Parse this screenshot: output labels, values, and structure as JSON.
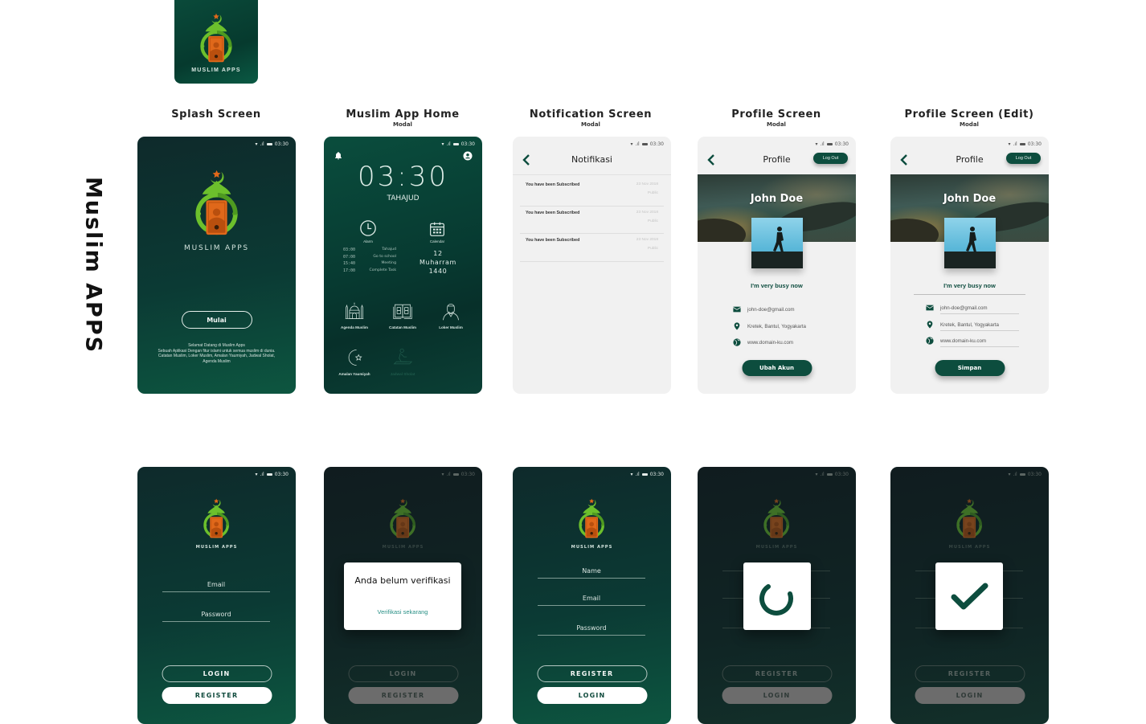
{
  "page": {
    "vertical_title": "Muslim APPS",
    "app_icon": {
      "brand": "MUSLIM APPS"
    }
  },
  "columns": [
    {
      "title": "Splash Screen",
      "subtitle": ""
    },
    {
      "title": "Muslim App Home",
      "subtitle": "Modal"
    },
    {
      "title": "Notification Screen",
      "subtitle": "Modal"
    },
    {
      "title": "Profile Screen",
      "subtitle": "Modal"
    },
    {
      "title": "Profile Screen (Edit)",
      "subtitle": "Modal"
    }
  ],
  "statusbar": {
    "time": "03:30",
    "icons": [
      "wifi-icon",
      "signal-icon",
      "battery-icon"
    ]
  },
  "colors": {
    "primary": "#0d4d3e",
    "logo_green": "#6cc02c",
    "logo_orange": "#e0681a",
    "star": "#e0681a",
    "link": "#2a9086"
  },
  "splash": {
    "brand": "MUSLIM APPS",
    "start_button": "Mulai",
    "welcome_lines": [
      "Selamat Datang di Muslim Apps",
      "Sebuah Aplikasi Dengan fitur islami untuk semua muslim di dunia.",
      "Catatan Muslim, Loker Muslim, Amalan Yaumiyah, Jadwal Sholat,",
      "Agenda Muslim"
    ]
  },
  "home": {
    "clock": "03:30",
    "prayer": "TAHAJUD",
    "alarm_label": "Alarm",
    "calendar_label": "Calendar",
    "alarms": [
      {
        "time": "03:00",
        "label": "Tahajud"
      },
      {
        "time": "07:00",
        "label": "Go to school"
      },
      {
        "time": "15:40",
        "label": "Meeting"
      },
      {
        "time": "17:00",
        "label": "Complete Task"
      }
    ],
    "hijri": {
      "day": "12",
      "month": "Muharram",
      "year": "1440"
    },
    "menu": [
      {
        "label": "Agenda Muslim",
        "icon": "mosque-icon",
        "enabled": true
      },
      {
        "label": "Catatan Muslim",
        "icon": "quran-book-icon",
        "enabled": true
      },
      {
        "label": "Loker Muslim",
        "icon": "muslim-man-icon",
        "enabled": true
      },
      {
        "label": "Amalan Yaumiyah",
        "icon": "crescent-star-icon",
        "enabled": true
      },
      {
        "label": "Jadwal Sholat",
        "icon": "praying-person-icon",
        "enabled": false
      }
    ]
  },
  "notifications": {
    "title": "Notifikasi",
    "items": [
      {
        "message": "You have been Subscribed",
        "date": "23 Nov 2018",
        "visibility": "Public"
      },
      {
        "message": "You have been Subscribed",
        "date": "23 Nov 2018",
        "visibility": "Public"
      },
      {
        "message": "You have been Subscribed",
        "date": "23 Nov 2018",
        "visibility": "Public"
      }
    ]
  },
  "profile": {
    "title": "Profile",
    "logout": "Log Out",
    "name": "John Doe",
    "status": "I'm very busy now",
    "email": "john-doe@gmail.com",
    "location": "Kretek, Bantul, Yogyakarta",
    "website": "www.domain-ku.com",
    "action": "Ubah Akun"
  },
  "profile_edit": {
    "title": "Profile",
    "logout": "Log Out",
    "name": "John Doe",
    "status": "I'm very busy now",
    "email": "john-doe@gmail.com",
    "location": "Kretek, Bantul, Yogyakarta",
    "website": "www.domain-ku.com",
    "action": "Simpan"
  },
  "login": {
    "brand": "MUSLIM APPS",
    "email_placeholder": "Email",
    "password_placeholder": "Password",
    "login": "LOGIN",
    "register": "REGISTER"
  },
  "verify_modal": {
    "brand": "MUSLIM APPS",
    "title": "Anda belum verifikasi",
    "link": "Verifikasi sekarang",
    "login": "LOGIN",
    "register": "REGISTER"
  },
  "register": {
    "brand": "MUSLIM APPS",
    "name_placeholder": "Name",
    "email_placeholder": "Email",
    "password_placeholder": "Password",
    "register": "REGISTER",
    "login": "LOGIN"
  },
  "register_loading": {
    "brand": "MUSLIM APPS",
    "register": "REGISTER",
    "login": "LOGIN",
    "state": "loading"
  },
  "register_success": {
    "brand": "MUSLIM APPS",
    "register": "REGISTER",
    "login": "LOGIN",
    "state": "success"
  }
}
